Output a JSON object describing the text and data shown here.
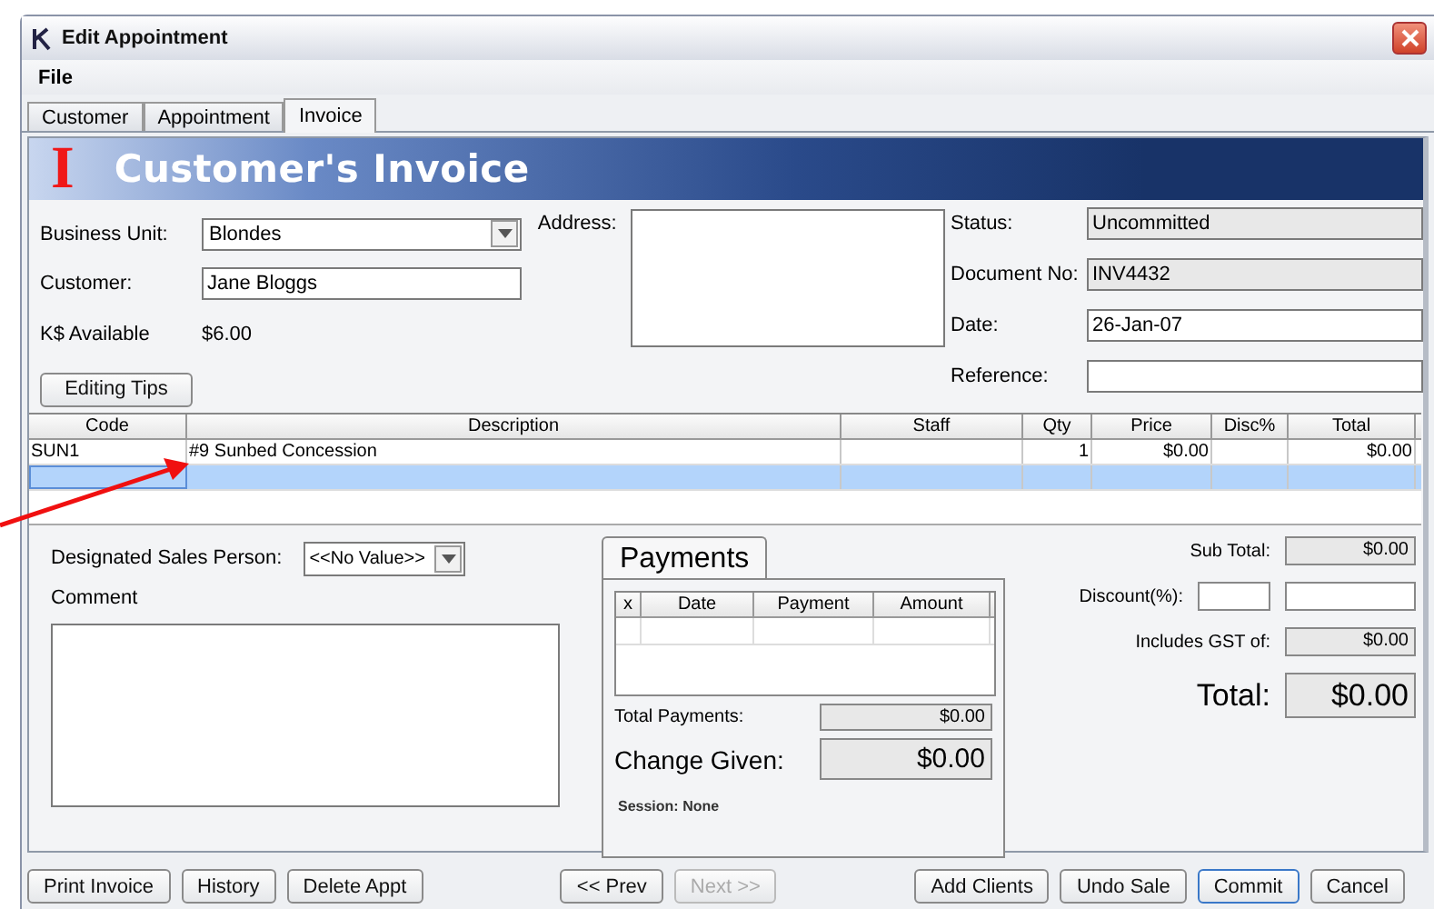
{
  "window": {
    "title": "Edit Appointment"
  },
  "menu": [
    "File"
  ],
  "tabs": [
    {
      "label": "Customer",
      "selected": false
    },
    {
      "label": "Appointment",
      "selected": false
    },
    {
      "label": "Invoice",
      "selected": true
    }
  ],
  "banner": {
    "mark": "I",
    "title": "Customer's Invoice"
  },
  "form": {
    "business_unit": {
      "label": "Business Unit:",
      "value": "Blondes"
    },
    "customer": {
      "label": "Customer:",
      "value": "Jane Bloggs"
    },
    "k_available": {
      "label": "K$ Available",
      "value": "$6.00"
    },
    "editing_tips": "Editing Tips",
    "address": {
      "label": "Address:"
    },
    "status": {
      "label": "Status:",
      "value": "Uncommitted"
    },
    "document_no": {
      "label": "Document No:",
      "value": "INV4432"
    },
    "date": {
      "label": "Date:",
      "value": "26-Jan-07"
    },
    "reference": {
      "label": "Reference:"
    }
  },
  "table": {
    "columns": [
      "Code",
      "Description",
      "Staff",
      "Qty",
      "Price",
      "Disc%",
      "Total"
    ],
    "rows": [
      {
        "cells": [
          "SUN1",
          "#9 Sunbed Concession",
          null,
          "1",
          "$0.00",
          null,
          "$0.00"
        ],
        "selected": false
      },
      {
        "cells": [
          null,
          null,
          null,
          null,
          null,
          null,
          null
        ],
        "selected": true
      }
    ]
  },
  "sales_person": {
    "label": "Designated Sales Person:",
    "value": "<<No Value>>"
  },
  "comment": {
    "label": "Comment"
  },
  "payments": {
    "title": "Payments",
    "columns": [
      "x",
      "Date",
      "Payment",
      "Amount"
    ],
    "total_label": "Total Payments:",
    "total_value": "$0.00",
    "change_label": "Change Given:",
    "change_value": "$0.00",
    "session": "Session: None"
  },
  "totals": {
    "sub_total_label": "Sub Total:",
    "sub_total": "$0.00",
    "discount_label": "Discount(%):",
    "gst_label": "Includes GST of:",
    "gst": "$0.00",
    "total_label": "Total:",
    "total": "$0.00"
  },
  "buttons": [
    {
      "label": "Print Invoice",
      "disabled": false,
      "default": false
    },
    {
      "label": "History",
      "disabled": false,
      "default": false
    },
    {
      "label": "Delete Appt",
      "disabled": false,
      "default": false
    },
    {
      "label": "<< Prev",
      "disabled": false,
      "default": false
    },
    {
      "label": "Next >>",
      "disabled": true,
      "default": false
    },
    {
      "label": "Add Clients",
      "disabled": false,
      "default": false
    },
    {
      "label": "Undo Sale",
      "disabled": false,
      "default": false
    },
    {
      "label": "Commit",
      "disabled": false,
      "default": true
    },
    {
      "label": "Cancel",
      "disabled": false,
      "default": false
    }
  ]
}
